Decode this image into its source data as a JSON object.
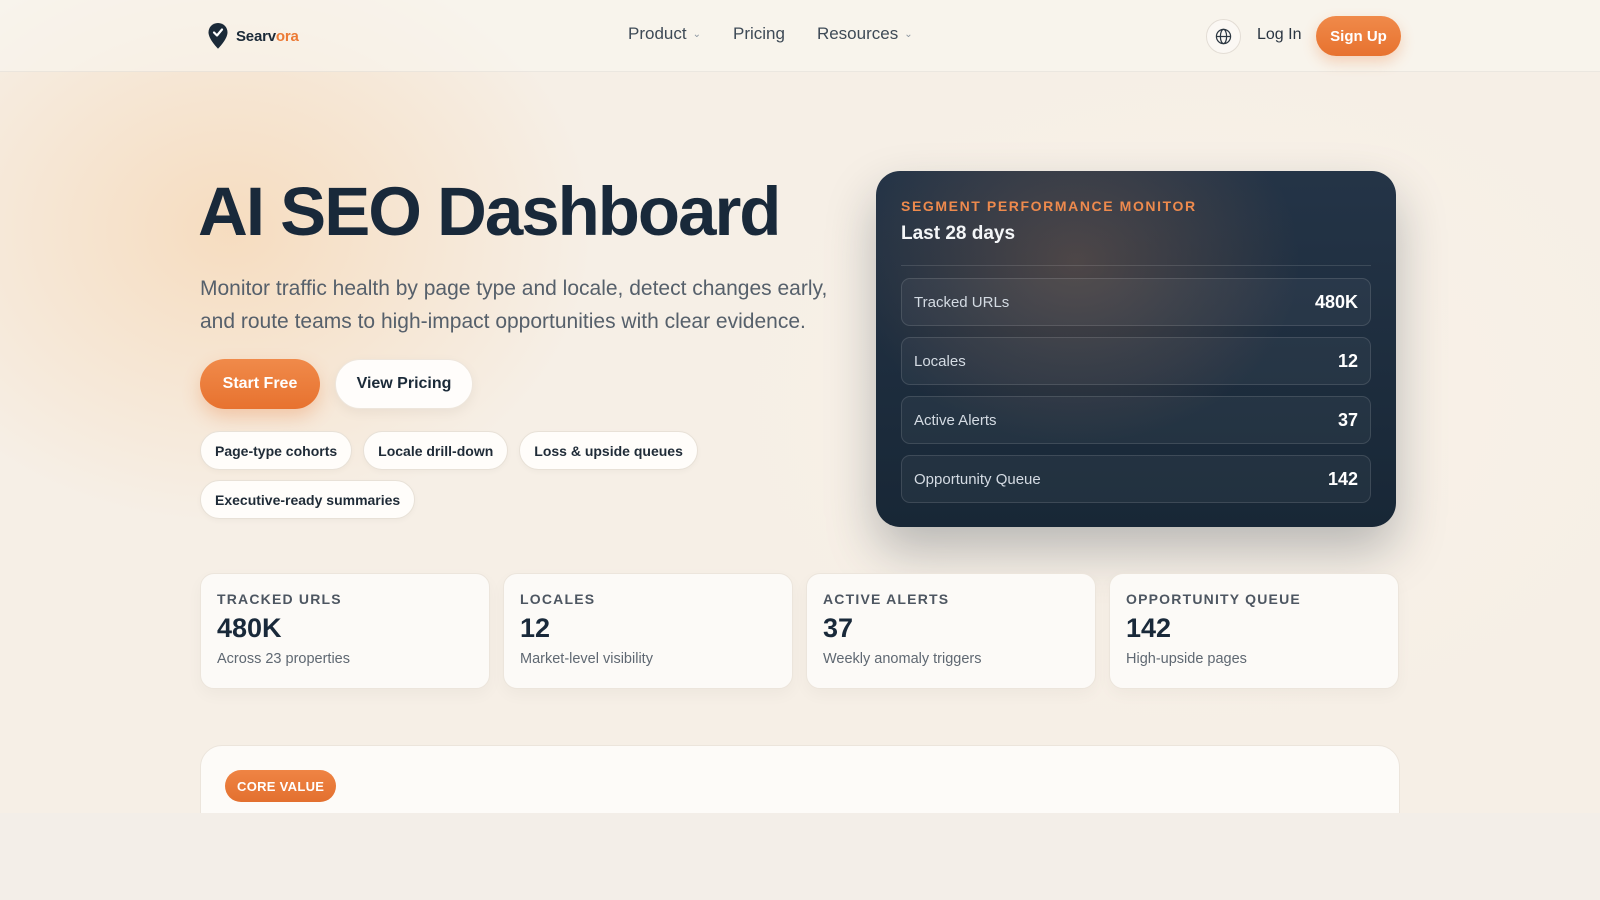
{
  "brand": {
    "name_prefix": "Searv",
    "name_accent": "ora",
    "accent_color": "#ec7a35"
  },
  "nav": {
    "links": [
      {
        "label": "Product",
        "has_dropdown": true
      },
      {
        "label": "Pricing",
        "has_dropdown": false
      },
      {
        "label": "Resources",
        "has_dropdown": true
      }
    ],
    "language_icon": "globe-icon",
    "login_label": "Log In",
    "signup_label": "Sign Up"
  },
  "hero": {
    "title": "AI SEO Dashboard",
    "subtitle": "Monitor traffic health by page type and locale, detect changes early, and route teams to high-impact opportunities with clear evidence.",
    "primary_cta": "Start Free",
    "secondary_cta": "View Pricing",
    "chips": [
      "Page-type cohorts",
      "Locale drill-down",
      "Loss & upside queues",
      "Executive-ready summaries"
    ]
  },
  "monitor": {
    "eyebrow": "SEGMENT PERFORMANCE MONITOR",
    "title": "Last 28 days",
    "rows": [
      {
        "label": "Tracked URLs",
        "value": "480K"
      },
      {
        "label": "Locales",
        "value": "12"
      },
      {
        "label": "Active Alerts",
        "value": "37"
      },
      {
        "label": "Opportunity Queue",
        "value": "142"
      }
    ]
  },
  "stats": [
    {
      "label": "TRACKED URLS",
      "value": "480K",
      "sub": "Across 23 properties"
    },
    {
      "label": "LOCALES",
      "value": "12",
      "sub": "Market-level visibility"
    },
    {
      "label": "ACTIVE ALERTS",
      "value": "37",
      "sub": "Weekly anomaly triggers"
    },
    {
      "label": "OPPORTUNITY QUEUE",
      "value": "142",
      "sub": "High-upside pages"
    }
  ],
  "core": {
    "badge": "CORE VALUE"
  }
}
